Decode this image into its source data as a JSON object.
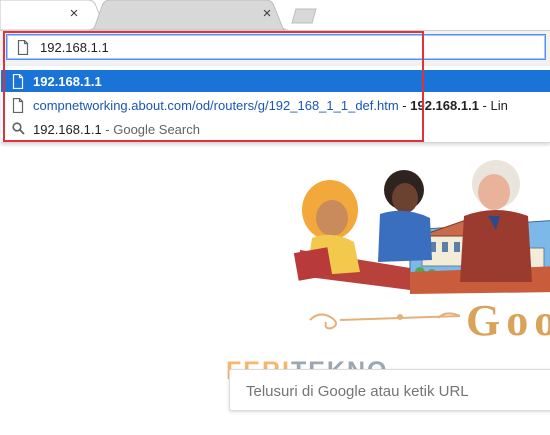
{
  "tabs": [
    {
      "close_glyph": "×"
    },
    {
      "close_glyph": "×"
    }
  ],
  "omnibox": {
    "value": "192.168.1.1"
  },
  "suggestions": [
    {
      "icon": "document-icon",
      "text": "192.168.1.1",
      "selected": true
    },
    {
      "icon": "document-icon",
      "url": "compnetworking.about.com/od/routers/g/192_168_1_1_def.htm",
      "separator": " - ",
      "title_bold": "192.168.1.1",
      "title_rest": " - Lin",
      "selected": false
    },
    {
      "icon": "search-icon",
      "query": "192.168.1.1",
      "suffix": " - Google Search",
      "selected": false
    }
  ],
  "doodle": {
    "partial_logo": "Goo"
  },
  "watermark": {
    "part1": "FERI",
    "part2": "TEKNO"
  },
  "search": {
    "placeholder": "Telusuri di Google atau ketik URL"
  },
  "colors": {
    "highlight": "#e0313c",
    "selection": "#1a73d7",
    "link": "#1a56b5"
  }
}
